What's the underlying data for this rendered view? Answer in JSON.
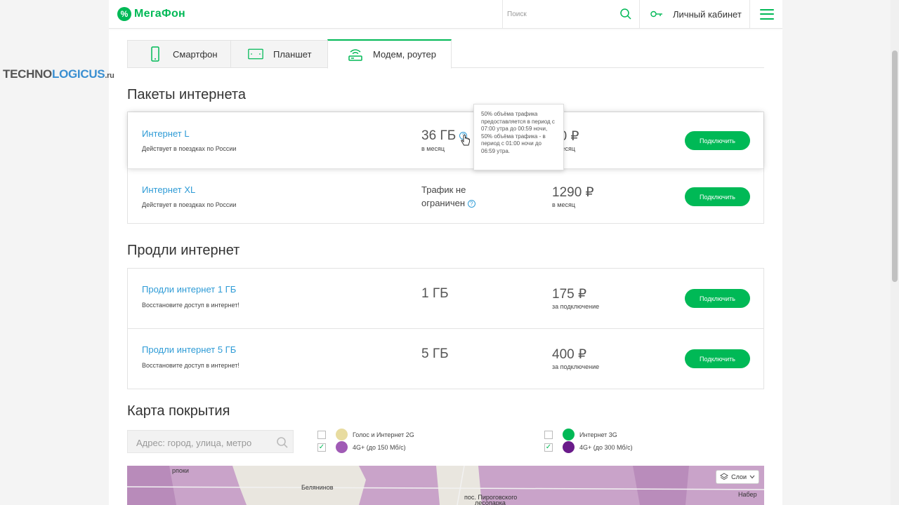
{
  "brand": {
    "logo_text": "МегаФон",
    "accent": "#00b956",
    "link_color": "#2e9bd6"
  },
  "header": {
    "search_placeholder": "Поиск",
    "cabinet_label": "Личный кабинет"
  },
  "watermark": {
    "part1": "TECHNO",
    "part2": "LOGICUS",
    "part3": ".ru"
  },
  "tabs": [
    {
      "label": "Смартфон",
      "icon": "smartphone-icon",
      "active": false
    },
    {
      "label": "Планшет",
      "icon": "tablet-icon",
      "active": false
    },
    {
      "label": "Модем, роутер",
      "icon": "router-icon",
      "active": true
    }
  ],
  "packages": {
    "title": "Пакеты интернета",
    "items": [
      {
        "name": "Интернет L",
        "desc": "Действует в поездках по России",
        "amount": "36 ГБ",
        "amount_sub": "в месяц",
        "price": "90 ₽",
        "price_sub": "в месяц",
        "button": "Подключить"
      },
      {
        "name": "Интернет XL",
        "desc": "Действует в поездках по России",
        "amount_line1": "Трафик не",
        "amount_line2": "ограничен",
        "price": "1290 ₽",
        "price_sub": "в месяц",
        "button": "Подключить"
      }
    ],
    "tooltip": "50% объёма трафика предоставляется в период с 07:00 утра до 00:59 ночи, 50% объёма трафика - в период с 01:00 ночи до 06:59 утра."
  },
  "extend": {
    "title": "Продли интернет",
    "items": [
      {
        "name": "Продли интернет 1 ГБ",
        "desc": "Восстановите доступ в интернет!",
        "amount": "1 ГБ",
        "price": "175 ₽",
        "price_sub": "за подключение",
        "button": "Подключить"
      },
      {
        "name": "Продли интернет 5 ГБ",
        "desc": "Восстановите доступ в интернет!",
        "amount": "5 ГБ",
        "price": "400 ₽",
        "price_sub": "за подключение",
        "button": "Подключить"
      }
    ]
  },
  "coverage": {
    "title": "Карта покрытия",
    "address_placeholder": "Адрес: город, улица, метро",
    "legend": [
      {
        "label": "Голос и Интернет 2G",
        "checked": false,
        "color": "#e8dca0"
      },
      {
        "label": "Интернет 3G",
        "checked": false,
        "color": "#00b956"
      },
      {
        "label": "4G+ (до 150 Мб/с)",
        "checked": true,
        "color": "#a05bb5"
      },
      {
        "label": "4G+ (до 300 Мб/с)",
        "checked": true,
        "color": "#6a1b8a"
      }
    ],
    "layers_label": "Слои",
    "map_labels": [
      "Белянинов",
      "рпоки",
      "пос. Пироговского",
      "лесопарка",
      "Набер"
    ]
  }
}
